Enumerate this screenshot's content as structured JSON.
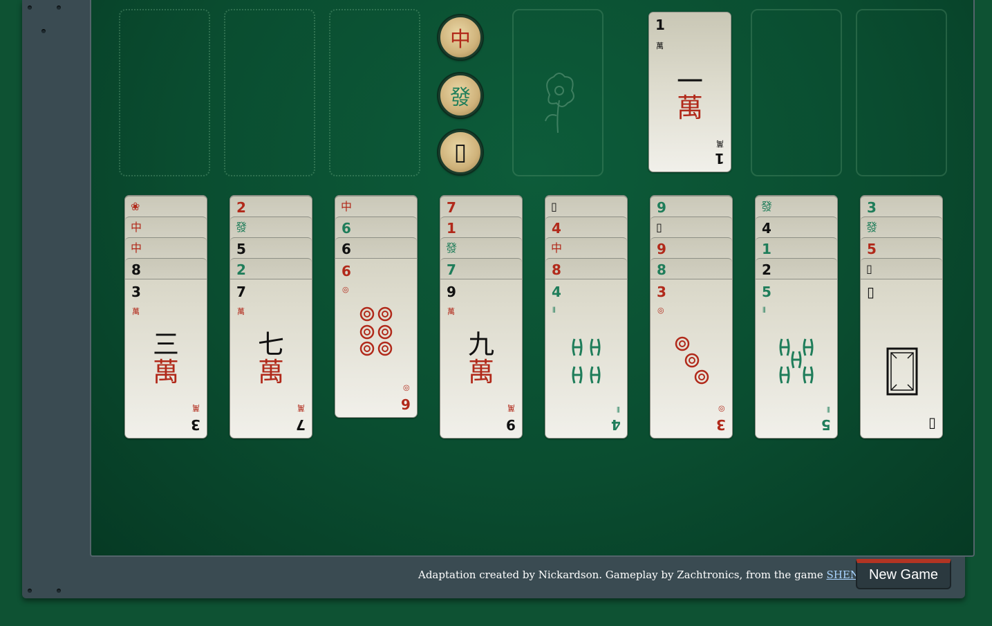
{
  "free_cells": [
    "free-cell-1",
    "free-cell-2",
    "free-cell-3"
  ],
  "dragon_buttons": [
    {
      "name": "red-dragon-button",
      "glyph": "中",
      "color": "#b1291a"
    },
    {
      "name": "green-dragon-button",
      "glyph": "發",
      "color": "#1f7d5a"
    },
    {
      "name": "white-dragon-button",
      "glyph": "▯",
      "color": "#111111"
    }
  ],
  "flower_slot": {
    "icon": "flower-icon"
  },
  "foundations": [
    {
      "empty": false,
      "rank": "1",
      "suit_glyph": "萬",
      "char": "一",
      "color": "red"
    },
    {
      "empty": true
    },
    {
      "empty": true
    }
  ],
  "tableau": [
    {
      "covered": [
        {
          "label": "❀",
          "color": "red"
        },
        {
          "label": "中",
          "color": "red"
        },
        {
          "label": "中",
          "color": "red"
        },
        {
          "label": "8",
          "color": "black"
        }
      ],
      "top": {
        "rank": "3",
        "suit": "萬",
        "char": "三",
        "color": "black",
        "suit_color": "red"
      }
    },
    {
      "covered": [
        {
          "label": "2",
          "color": "red"
        },
        {
          "label": "發",
          "color": "green"
        },
        {
          "label": "5",
          "color": "black"
        },
        {
          "label": "2",
          "color": "green"
        }
      ],
      "top": {
        "rank": "7",
        "suit": "萬",
        "char": "七",
        "color": "black",
        "suit_color": "red"
      }
    },
    {
      "covered": [
        {
          "label": "中",
          "color": "red"
        },
        {
          "label": "6",
          "color": "green"
        },
        {
          "label": "6",
          "color": "black"
        }
      ],
      "top": {
        "rank": "6",
        "suit": "◎",
        "char": "",
        "color": "red",
        "suit_color": "red",
        "pattern": "coins6"
      }
    },
    {
      "covered": [
        {
          "label": "7",
          "color": "red"
        },
        {
          "label": "1",
          "color": "red"
        },
        {
          "label": "發",
          "color": "green"
        },
        {
          "label": "7",
          "color": "green"
        }
      ],
      "top": {
        "rank": "9",
        "suit": "萬",
        "char": "九",
        "color": "black",
        "suit_color": "red"
      }
    },
    {
      "covered": [
        {
          "label": "▯",
          "color": "black"
        },
        {
          "label": "4",
          "color": "red"
        },
        {
          "label": "中",
          "color": "red"
        },
        {
          "label": "8",
          "color": "red"
        }
      ],
      "top": {
        "rank": "4",
        "suit": "⦀",
        "char": "",
        "color": "green",
        "suit_color": "green",
        "pattern": "bamboo4"
      }
    },
    {
      "covered": [
        {
          "label": "9",
          "color": "green"
        },
        {
          "label": "▯",
          "color": "black"
        },
        {
          "label": "9",
          "color": "red"
        },
        {
          "label": "8",
          "color": "green"
        }
      ],
      "top": {
        "rank": "3",
        "suit": "◎",
        "char": "",
        "color": "red",
        "suit_color": "red",
        "pattern": "coins3"
      }
    },
    {
      "covered": [
        {
          "label": "發",
          "color": "green"
        },
        {
          "label": "4",
          "color": "black"
        },
        {
          "label": "1",
          "color": "green"
        },
        {
          "label": "2",
          "color": "black"
        }
      ],
      "top": {
        "rank": "5",
        "suit": "⦀",
        "char": "",
        "color": "green",
        "suit_color": "green",
        "pattern": "bamboo5"
      }
    },
    {
      "covered": [
        {
          "label": "3",
          "color": "green"
        },
        {
          "label": "發",
          "color": "green"
        },
        {
          "label": "5",
          "color": "red"
        },
        {
          "label": "▯",
          "color": "black"
        }
      ],
      "top": {
        "rank": "▯",
        "suit": "",
        "char": "",
        "color": "black",
        "suit_color": "black",
        "pattern": "whitedragon"
      }
    }
  ],
  "footer": {
    "credit_text": "Adaptation created by Nickardson. Gameplay by Zachtronics, from the game ",
    "credit_link": "SHENZHEN I/O",
    "new_game_label": "New Game"
  },
  "colors": {
    "red": "#b1291a",
    "green": "#1f7d5a",
    "black": "#111111",
    "felt": "#0a4d30"
  }
}
